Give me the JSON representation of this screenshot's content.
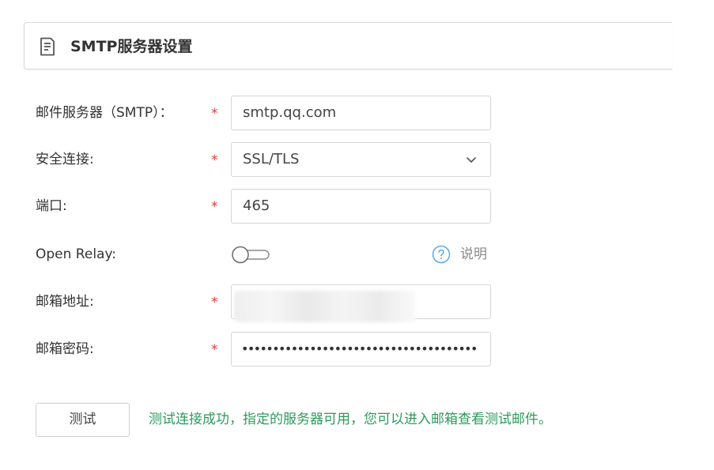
{
  "header": {
    "title": "SMTP服务器设置",
    "icon": "document-icon"
  },
  "form": {
    "smtp_server": {
      "label": "邮件服务器（SMTP）：",
      "required_mark": "*",
      "value": "smtp.qq.com"
    },
    "secure_connection": {
      "label": "安全连接:",
      "required_mark": "*",
      "value": "SSL/TLS"
    },
    "port": {
      "label": "端口:",
      "required_mark": "*",
      "value": "465"
    },
    "open_relay": {
      "label": "Open Relay:",
      "enabled": false,
      "help_text": "说明"
    },
    "email_address": {
      "label": "邮箱地址:",
      "required_mark": "*"
    },
    "email_password": {
      "label": "邮箱密码:",
      "required_mark": "*",
      "value": "••••••••••••••••••••••••••••••••••••••"
    }
  },
  "actions": {
    "test_label": "测试",
    "result_message": "测试连接成功，指定的服务器可用，您可以进入邮箱查看测试邮件。"
  },
  "colors": {
    "required": "#e53935",
    "success": "#2e9a5c",
    "help_icon": "#5aa9e6",
    "border": "#d6d6d6"
  }
}
